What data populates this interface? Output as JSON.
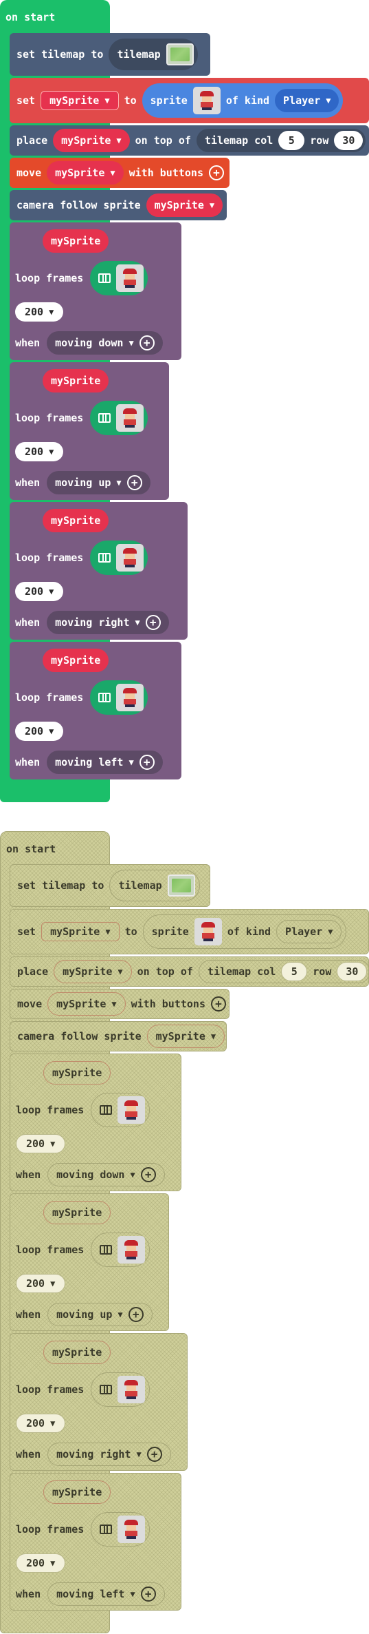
{
  "colors": {
    "hat_green": "#1bbf6a",
    "scene_slate": "#4b5d7a",
    "sprites_red": "#e14a4a",
    "controller_orange": "#e44a2a",
    "animation_purple": "#7a5b82",
    "sprite_pill_red": "#e6324e",
    "sprite_kind_blue": "#4a86e0",
    "frames_green": "#1aa86a",
    "ghost_olive": "#cfcf9a"
  },
  "event": {
    "title": "on start"
  },
  "set_tilemap": {
    "label": "set tilemap to",
    "pill": "tilemap",
    "thumb_icon": "tilemap-thumbnail"
  },
  "set_sprite": {
    "label": "set",
    "var": "mySprite",
    "to": "to",
    "sprite_label": "sprite",
    "of_kind": "of kind",
    "kind": "Player",
    "thumb_icon": "hero-sprite-thumbnail"
  },
  "place": {
    "label": "place",
    "var": "mySprite",
    "on_top_of": "on top of",
    "tilemap_col": "tilemap col",
    "col": "5",
    "row_label": "row",
    "row": "30"
  },
  "move": {
    "label": "move",
    "var": "mySprite",
    "with_buttons": "with buttons"
  },
  "camera": {
    "label": "camera follow sprite",
    "var": "mySprite"
  },
  "animations": [
    {
      "var": "mySprite",
      "loop": "loop frames",
      "interval": "200",
      "when": "when",
      "condition": "moving down"
    },
    {
      "var": "mySprite",
      "loop": "loop frames",
      "interval": "200",
      "when": "when",
      "condition": "moving up"
    },
    {
      "var": "mySprite",
      "loop": "loop frames",
      "interval": "200",
      "when": "when",
      "condition": "moving right"
    },
    {
      "var": "mySprite",
      "loop": "loop frames",
      "interval": "200",
      "when": "when",
      "condition": "moving left"
    }
  ]
}
